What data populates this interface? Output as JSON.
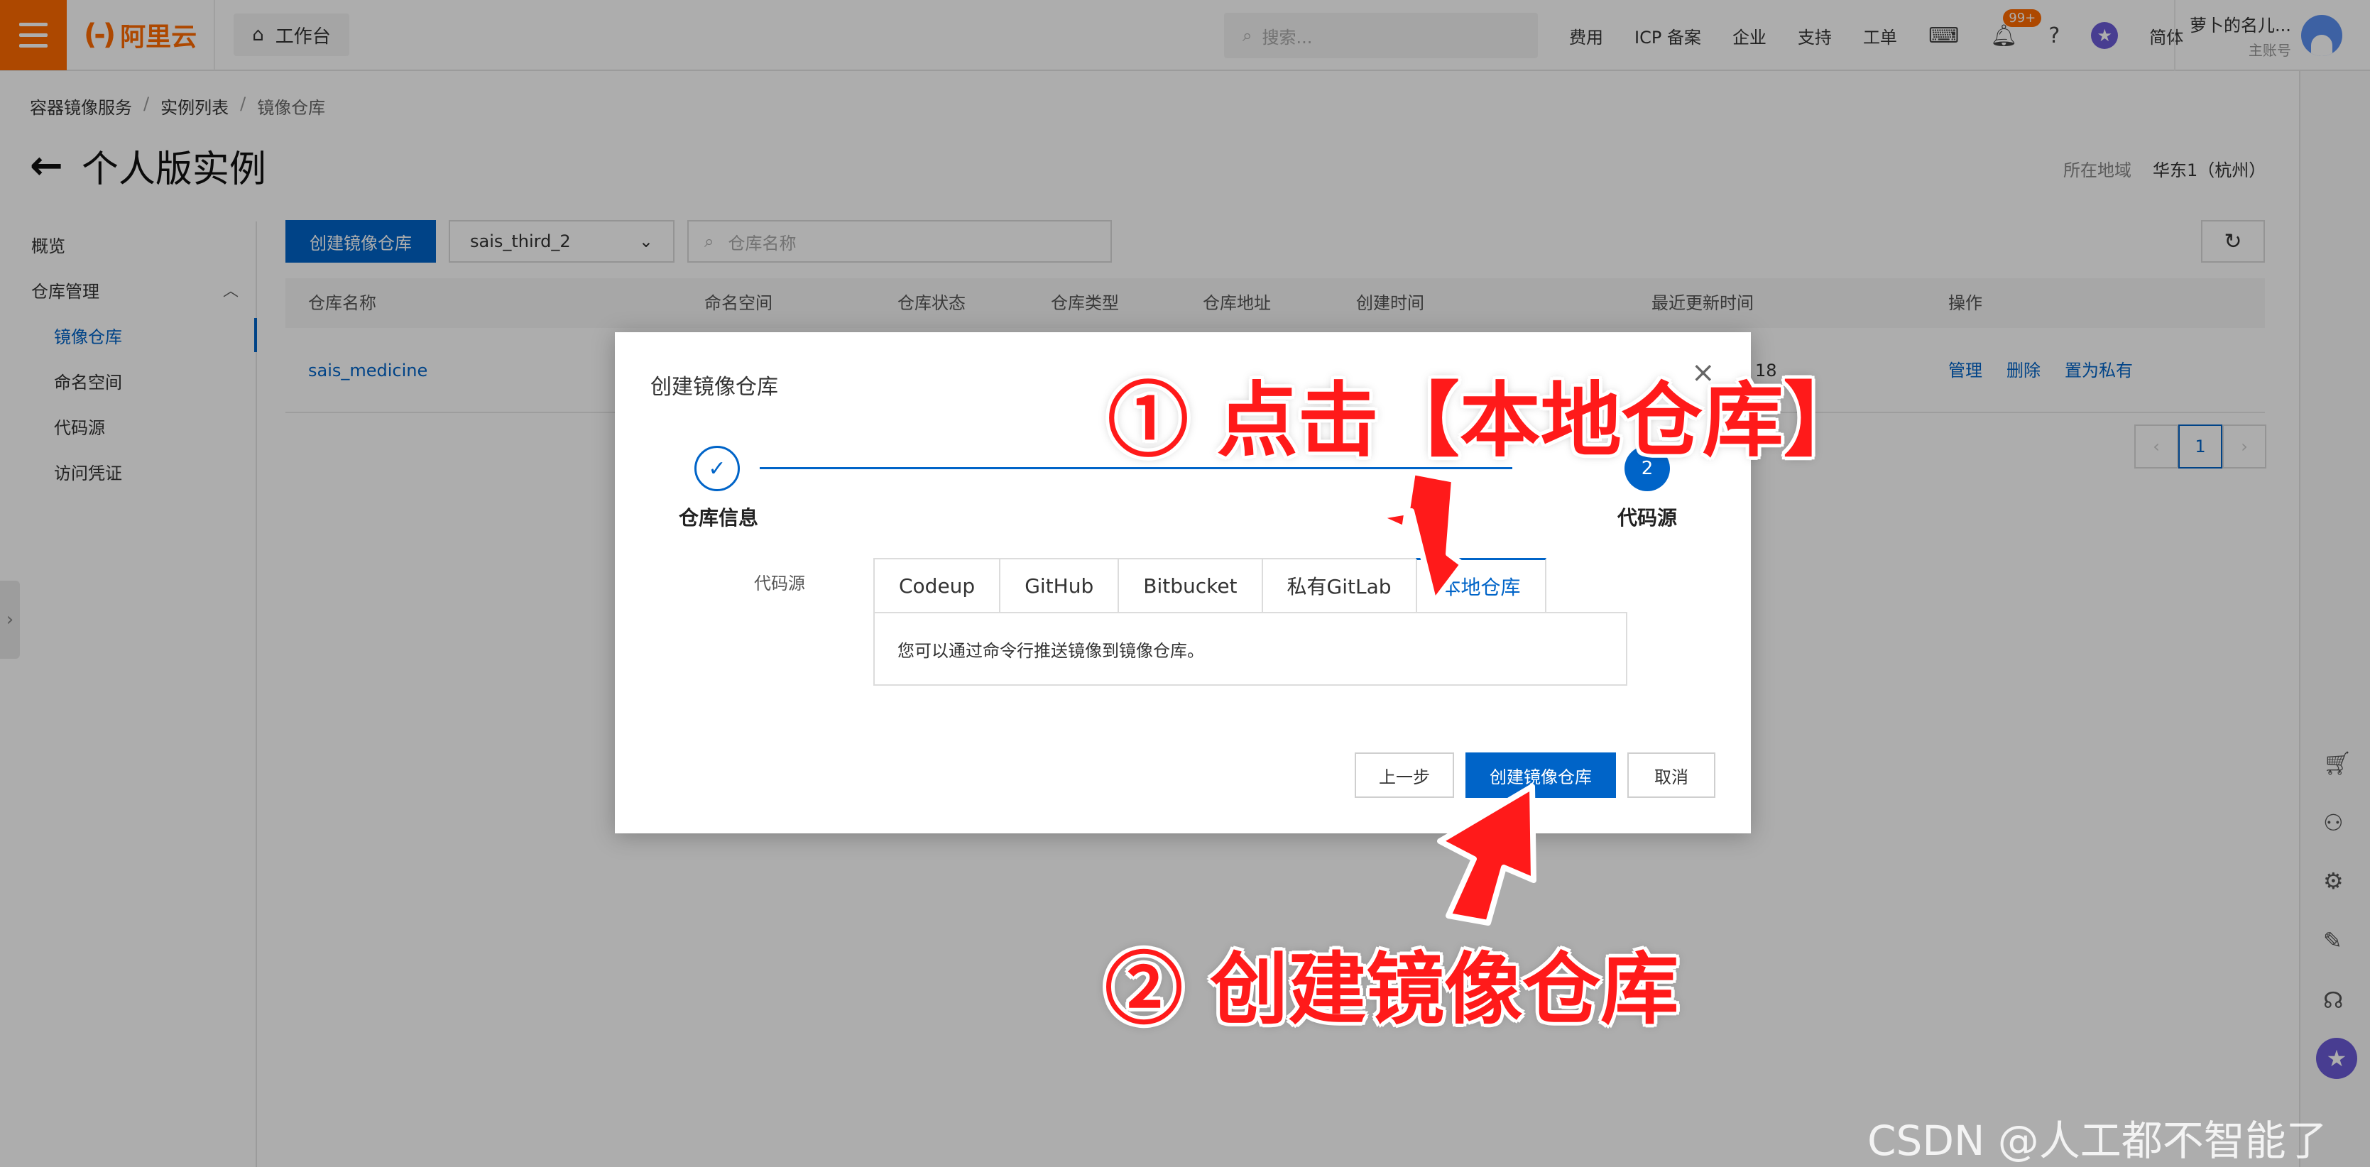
{
  "topbar": {
    "logo_mark": "(-)",
    "logo_text": "阿里云",
    "workbench": "工作台",
    "search_placeholder": "搜索...",
    "links": [
      "费用",
      "ICP 备案",
      "企业",
      "支持",
      "工单"
    ],
    "notification_badge": "99+",
    "language": "简体",
    "account_name": "萝卜的名儿...",
    "account_type": "主账号"
  },
  "breadcrumb": [
    "容器镜像服务",
    "实例列表",
    "镜像仓库"
  ],
  "page": {
    "title": "个人版实例",
    "region_label": "所在地域",
    "region_value": "华东1（杭州）"
  },
  "sidebar": {
    "overview": "概览",
    "repo_mgmt": "仓库管理",
    "items": [
      "镜像仓库",
      "命名空间",
      "代码源",
      "访问凭证"
    ]
  },
  "toolbar": {
    "create_label": "创建镜像仓库",
    "namespace": "sais_third_2",
    "search_placeholder": "仓库名称"
  },
  "table": {
    "headers": [
      "仓库名称",
      "命名空间",
      "仓库状态",
      "仓库类型",
      "仓库地址",
      "创建时间",
      "最近更新时间",
      "操作"
    ],
    "row": {
      "name": "sais_medicine",
      "partial": "18",
      "actions": [
        "管理",
        "删除",
        "置为私有"
      ]
    },
    "page_number": "1"
  },
  "modal": {
    "title": "创建镜像仓库",
    "close": "×",
    "step1": "仓库信息",
    "step2_num": "2",
    "step2": "代码源",
    "source_label": "代码源",
    "tabs": [
      "Codeup",
      "GitHub",
      "Bitbucket",
      "私有GitLab",
      "本地仓库"
    ],
    "panel_text": "您可以通过命令行推送镜像到镜像仓库。",
    "btn_prev": "上一步",
    "btn_create": "创建镜像仓库",
    "btn_cancel": "取消"
  },
  "annotations": {
    "step1": "① 点击【本地仓库】",
    "step2": "② 创建镜像仓库"
  },
  "watermark": "CSDN @人工都不智能了",
  "colors": {
    "primary": "#0064c8",
    "brand": "#ff6a00",
    "annotation": "#ff1a1a"
  }
}
